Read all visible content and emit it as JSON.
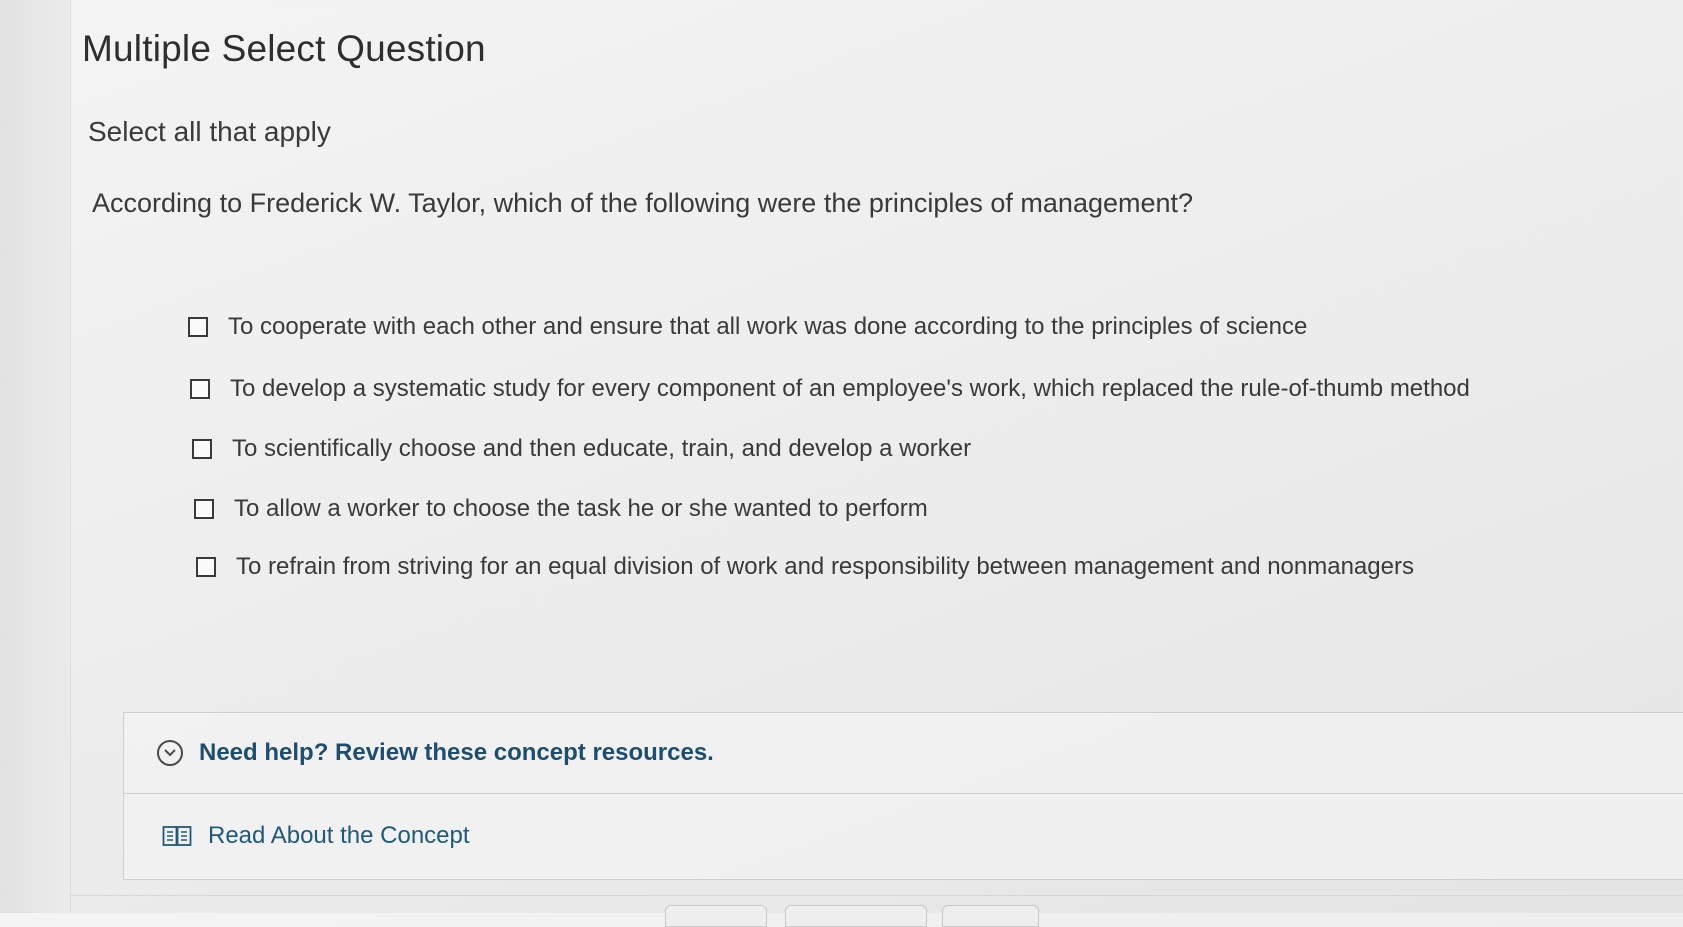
{
  "header": {
    "title": "Multiple Select Question",
    "instruction": "Select all that apply"
  },
  "question": {
    "text": "According to Frederick W. Taylor, which of the following were the principles of management?"
  },
  "options": [
    {
      "label": "To cooperate with each other and ensure that all work was done according to the principles of science",
      "checked": false
    },
    {
      "label": "To develop a systematic study for every component of an employee's work, which replaced the rule-of-thumb method",
      "checked": false
    },
    {
      "label": "To scientifically choose and then educate, train, and develop a worker",
      "checked": false
    },
    {
      "label": "To allow a worker to choose the task he or she wanted to perform",
      "checked": false
    },
    {
      "label": "To refrain from striving for an equal division of work and responsibility between management and nonmanagers",
      "checked": false
    }
  ],
  "help": {
    "toggle_label": "Need help? Review these concept resources.",
    "toggle_icon": "chevron-down-circle-icon",
    "resource_label": "Read About the Concept",
    "resource_icon": "book-icon"
  },
  "colors": {
    "help_link": "#1e4e6e",
    "resource_link": "#1f5a7a"
  }
}
